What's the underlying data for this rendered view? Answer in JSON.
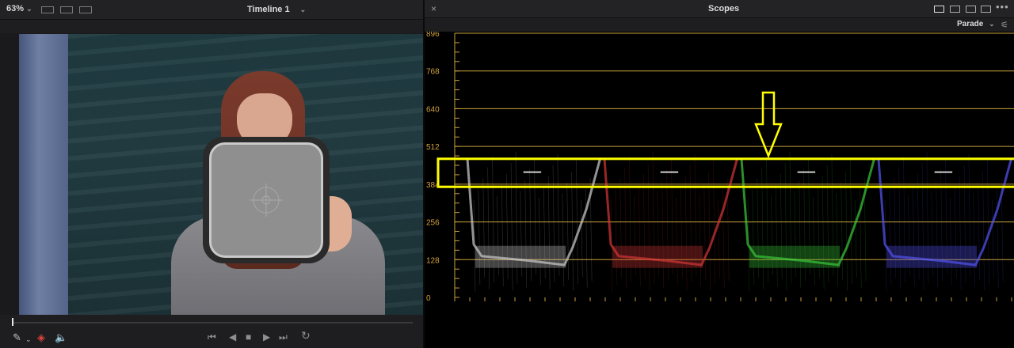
{
  "viewer": {
    "zoom": "63%",
    "zoom_chevron": "⌄",
    "timeline_title": "Timeline 1",
    "timeline_chevron": "⌄",
    "tools": {
      "pick": "✎",
      "pick_chevron": "⌄",
      "layers": "◈",
      "volume": "🔈"
    },
    "transport": {
      "skip_back": "⏮",
      "reverse": "◀",
      "stop": "■",
      "play": "▶",
      "skip_forward": "⏭",
      "loop": "↻"
    }
  },
  "scopes": {
    "title": "Scopes",
    "close": "×",
    "more": "•••",
    "mode": "Parade",
    "mode_chevron": "⌄",
    "settings_icon": "⚟",
    "grid_color": "#c8a23a",
    "label_color": "#d2a33c",
    "highlight_color": "#ffff00",
    "y_labels": [
      "896",
      "768",
      "640",
      "512",
      "384",
      "256",
      "128",
      "0"
    ],
    "parade": [
      {
        "channel": "white",
        "color": "#d8d8d8"
      },
      {
        "channel": "red",
        "color": "#e03a3a"
      },
      {
        "channel": "green",
        "color": "#3fd33f"
      },
      {
        "channel": "blue",
        "color": "#5a5aff"
      }
    ]
  }
}
